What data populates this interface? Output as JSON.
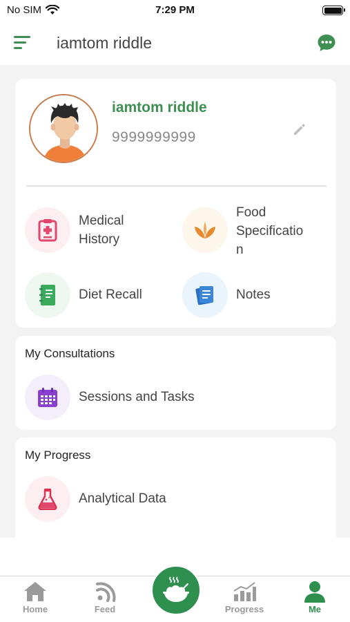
{
  "status_bar": {
    "carrier": "No SIM",
    "time": "7:29 PM"
  },
  "header": {
    "title": "iamtom riddle",
    "menu_icon": "menu-icon",
    "chat_icon": "chat-icon",
    "accent": "#3f8f52"
  },
  "profile": {
    "name": "iamtom riddle",
    "phone": "9999999999"
  },
  "tiles": [
    {
      "label_line1": "Medical",
      "label_line2": "History",
      "icon": "clipboard-icon",
      "color": "#e0476b"
    },
    {
      "label_line1": "Food",
      "label_line2": "Specificatio",
      "label_line3": "n",
      "icon": "leaf-icon",
      "color": "#e8892f"
    },
    {
      "label": "Diet Recall",
      "icon": "notebook-icon",
      "color": "#3aab5c"
    },
    {
      "label": "Notes",
      "icon": "notes-icon",
      "color": "#3a86d8"
    }
  ],
  "consultations": {
    "title": "My Consultations",
    "item_label": "Sessions and Tasks",
    "icon": "calendar-icon"
  },
  "progress": {
    "title": "My Progress",
    "item_label": "Analytical Data",
    "icon": "flask-icon"
  },
  "bottom_nav": {
    "items": [
      {
        "label": "Home",
        "icon": "home-icon"
      },
      {
        "label": "Feed",
        "icon": "feed-icon"
      },
      {
        "label": "Progress",
        "icon": "bar-chart-icon"
      },
      {
        "label": "Me",
        "icon": "user-icon"
      }
    ],
    "active": "Me",
    "center_icon": "food-bowl-icon"
  }
}
